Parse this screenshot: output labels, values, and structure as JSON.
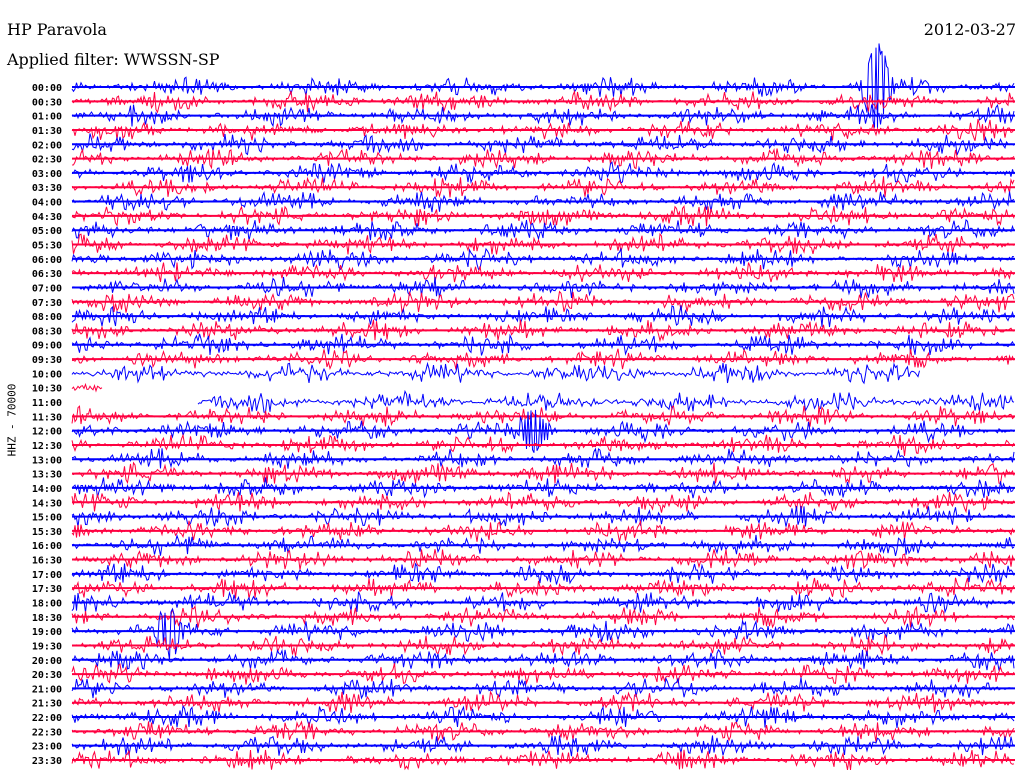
{
  "header": {
    "station": "HP Paravola",
    "date": "2012-03-27",
    "filter": "Applied filter: WWSSN-SP",
    "channel": "HHZ - 70000"
  },
  "chart_data": {
    "type": "line",
    "title": "HP Paravola",
    "subtitle": "Applied filter: WWSSN-SP",
    "ylabel": "HHZ - 70000",
    "xlabel": "",
    "colors": [
      "#0000ff",
      "#ff0040"
    ],
    "row_labels": [
      "00:00",
      "00:30",
      "01:00",
      "01:30",
      "02:00",
      "02:30",
      "03:00",
      "03:30",
      "04:00",
      "04:30",
      "05:00",
      "05:30",
      "06:00",
      "06:30",
      "07:00",
      "07:30",
      "08:00",
      "08:30",
      "09:00",
      "09:30",
      "10:00",
      "10:30",
      "11:00",
      "11:30",
      "12:00",
      "12:30",
      "13:00",
      "13:30",
      "14:00",
      "14:30",
      "15:00",
      "15:30",
      "16:00",
      "16:30",
      "17:00",
      "17:30",
      "18:00",
      "18:30",
      "19:00",
      "19:30",
      "20:00",
      "20:30",
      "21:00",
      "21:30",
      "22:00",
      "22:30",
      "23:00",
      "23:30"
    ],
    "row_minutes": 30,
    "gaps": [
      {
        "row": "10:00",
        "from_min": 27,
        "to_min": 30
      },
      {
        "row": "10:30",
        "from_min": 1,
        "to_min": 30
      },
      {
        "row": "11:00",
        "from_min": 0,
        "to_min": 4
      }
    ],
    "events": [
      {
        "row": "00:00",
        "minute": 25.6,
        "amplitude": "large"
      },
      {
        "row": "12:00",
        "minute": 14.7,
        "amplitude": "medium"
      },
      {
        "row": "19:00",
        "minute": 3.1,
        "amplitude": "medium"
      }
    ]
  }
}
